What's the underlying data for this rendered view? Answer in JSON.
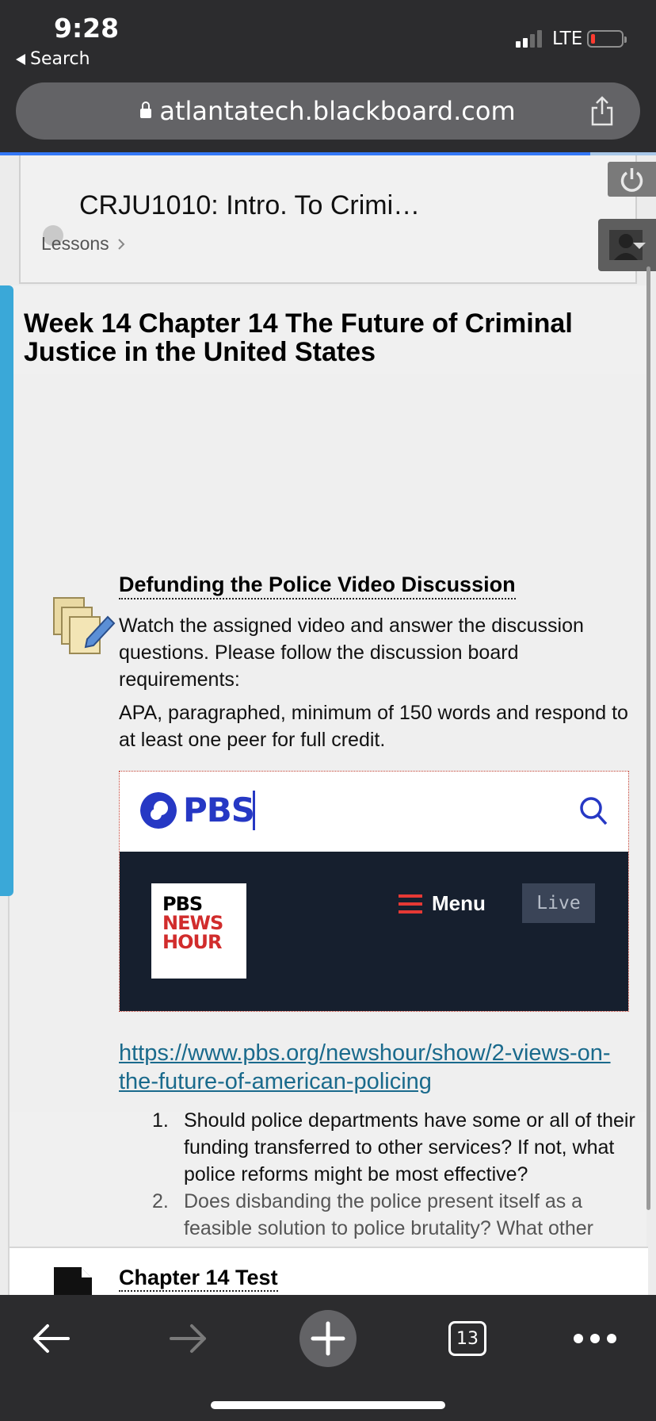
{
  "status_bar": {
    "time": "9:28",
    "back_label": "Search",
    "network": "LTE"
  },
  "browser": {
    "url": "atlantatech.blackboard.com",
    "load_progress": 0.9,
    "tab_count": "13"
  },
  "course": {
    "title": "CRJU1010: Intro. To Crimi…",
    "breadcrumb": "Lessons"
  },
  "week": {
    "title": "Week 14 Chapter 14 The Future of Criminal Justice in the United States"
  },
  "discussion": {
    "title": "Defunding the Police Video Discussion",
    "paragraph1": "Watch the assigned video and answer the discussion questions.  Please follow the discussion board requirements:",
    "paragraph2": "APA, paragraphed, minimum of 150 words and respond to at least one peer for full credit.",
    "embed": {
      "brand": "PBS",
      "newshour_line1": "PBS",
      "newshour_line2": "NEWS",
      "newshour_line3": "HOUR",
      "menu_label": "Menu",
      "live_label": "Live"
    },
    "link": "https://www.pbs.org/newshour/show/2-views-on-the-future-of-american-policing",
    "questions": [
      {
        "num": "1.",
        "text": "Should police departments have some or all of their funding transferred to other services? If not, what police reforms might be most effective?"
      },
      {
        "num": "2.",
        "text": "Does disbanding the police present itself as a feasible solution to police brutality? What other strategies exist for reforming police departments?"
      }
    ]
  },
  "next_item": {
    "title": "Chapter 14 Test"
  },
  "colors": {
    "pbs_blue": "#2638c4",
    "newshour_red": "#d12c2c",
    "link": "#1a6a8c",
    "accent_bar": "#3aa8d8"
  }
}
